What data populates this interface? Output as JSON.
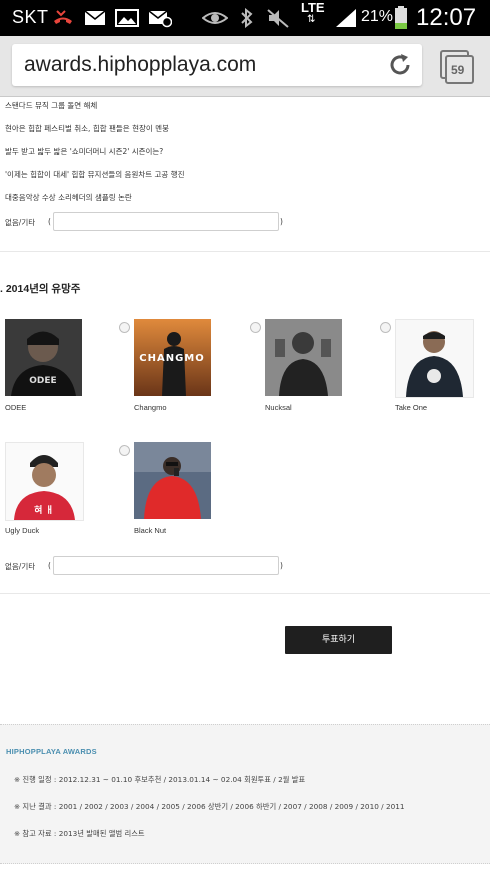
{
  "status_bar": {
    "carrier": "SKT",
    "network": "LTE",
    "battery_percent": "21%",
    "time": "12:07",
    "icons": [
      "missed-call-icon",
      "mail-icon",
      "image-icon",
      "mail-sync-icon",
      "eye-icon",
      "bluetooth-icon",
      "mute-icon",
      "lte-icon",
      "signal-icon",
      "battery-icon"
    ],
    "battery_color": "#7ac943"
  },
  "browser": {
    "url": "awards.hiphopplaya.com",
    "tab_count": "59"
  },
  "news_list": [
    "스탠다드 뮤직 그룹 돌연 해체",
    "현아은 힙합 페스티벌 취소, 힙합 팬들은 현장이 멘붕",
    "발두 받고 밟두 밟은 '쇼미더머니 시즌2' 시즌이는?",
    "'이제는 힙합이 대세' 힙합 뮤지션들의 음원차트 고공 행진",
    "대중음악상 수상 소리헤더의 샘플링 논란"
  ],
  "other_input_label": "없음/기타",
  "section": {
    "title": ". 2014년의 유망주",
    "candidates": [
      {
        "name": "ODEE"
      },
      {
        "name": "Changmo",
        "cover_text": "CHANGMO"
      },
      {
        "name": "Nucksal"
      },
      {
        "name": "Take One"
      },
      {
        "name": "Ugly Duck"
      },
      {
        "name": "Black Nut"
      }
    ],
    "other_input_label": "없음/기타"
  },
  "vote_button": "투표하기",
  "footer": {
    "title": "HIPHOPPLAYA AWARDS",
    "lines": [
      "※ 진행 일정 : 2012.12.31 ~ 01.10 후보추천  /  2013.01.14 ~ 02.04 회원투표  /  2월 발표",
      "※ 지난 결과 : 2001  /  2002  /  2003  /  2004  /  2005  /  2006 상반기  /  2006 하반기  /  2007  /  2008  /  2009  /  2010  /  2011",
      "※ 참고 자료 : 2013년 발매된 앨범 리스트"
    ],
    "accent_color": "#4b8fb0"
  }
}
